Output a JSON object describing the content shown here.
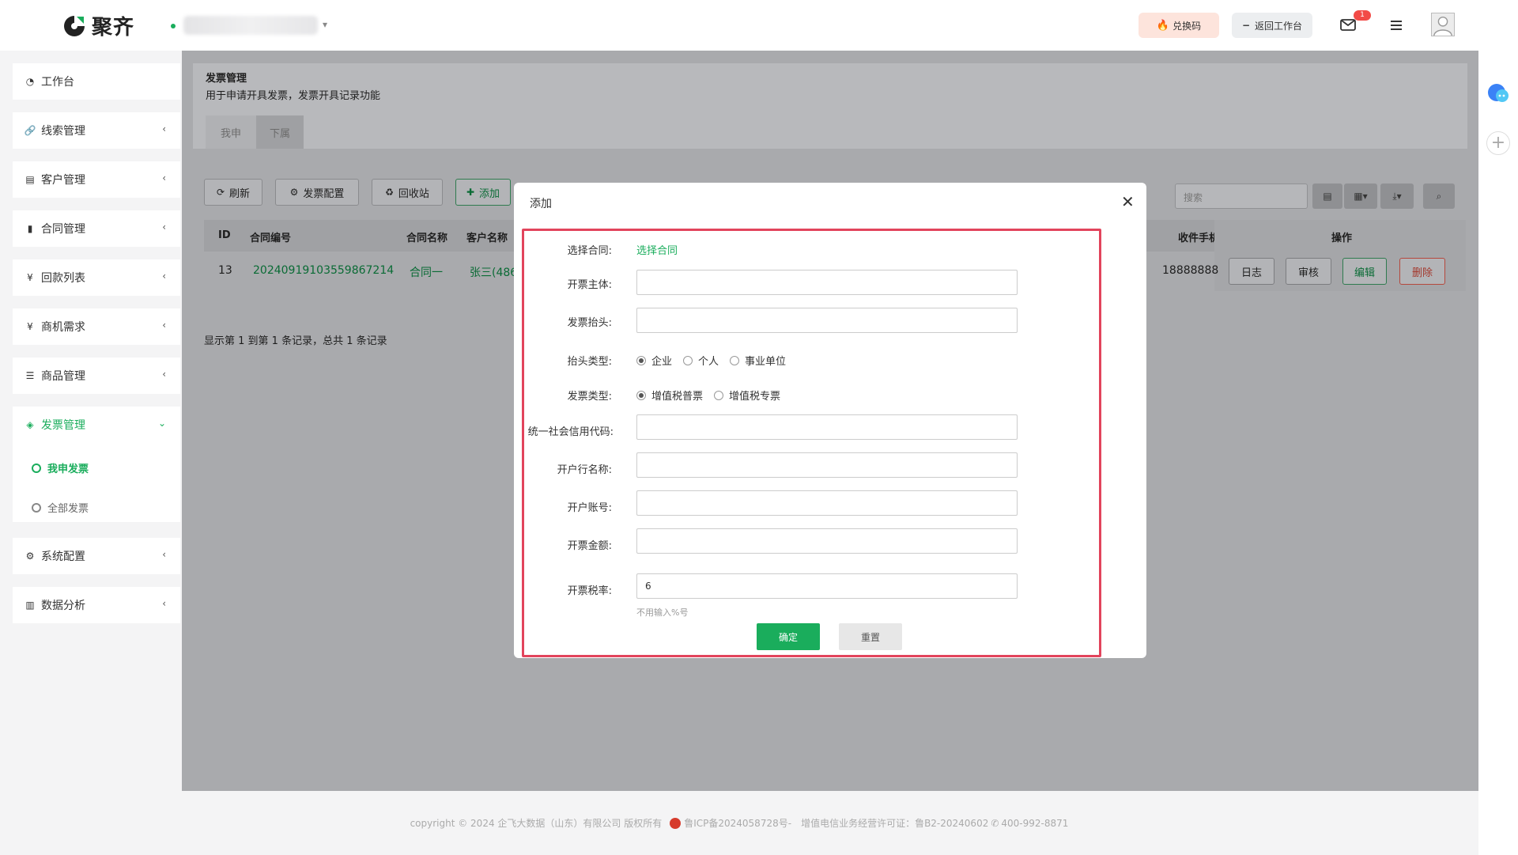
{
  "header": {
    "logo_text": "聚齐",
    "redeem_label": "兑换码",
    "back_label": "返回工作台",
    "mail_badge": "1",
    "accent": "#1aad5c"
  },
  "sidebar": {
    "items": [
      {
        "label": "工作台",
        "icon": "dashboard-icon"
      },
      {
        "label": "线索管理",
        "icon": "link-icon"
      },
      {
        "label": "客户管理",
        "icon": "id-card-icon"
      },
      {
        "label": "合同管理",
        "icon": "bookmark-icon"
      },
      {
        "label": "回款列表",
        "icon": "yen-icon"
      },
      {
        "label": "商机需求",
        "icon": "yen-icon"
      },
      {
        "label": "商品管理",
        "icon": "list-icon"
      },
      {
        "label": "发票管理",
        "icon": "tag-icon"
      },
      {
        "label": "系统配置",
        "icon": "gears-icon"
      },
      {
        "label": "数据分析",
        "icon": "bar-chart-icon"
      }
    ],
    "sub_items": [
      {
        "label": "我申发票",
        "active": true
      },
      {
        "label": "全部发票",
        "active": false
      }
    ]
  },
  "page": {
    "title": "发票管理",
    "description": "用于申请开具发票，发票开具记录功能",
    "tabs": [
      "我申",
      "下属"
    ]
  },
  "toolbar": {
    "refresh": "刷新",
    "config": "发票配置",
    "recycle": "回收站",
    "add": "添加",
    "search_placeholder": "搜索"
  },
  "table": {
    "columns": [
      "ID",
      "合同编号",
      "合同名称",
      "客户名称",
      "收件手机",
      "操作"
    ],
    "rows": [
      {
        "id": "13",
        "contract_no": "20240919103559867214",
        "contract_name": "合同一",
        "customer": "张三(486",
        "phone": "18888888"
      }
    ],
    "row_actions": [
      "日志",
      "审核",
      "编辑",
      "删除"
    ],
    "summary": "显示第 1 到第 1 条记录，总共 1 条记录"
  },
  "modal": {
    "title": "添加",
    "fields": {
      "contract_label": "选择合同:",
      "contract_link": "选择合同",
      "issuer_label": "开票主体:",
      "header_label": "发票抬头:",
      "header_type_label": "抬头类型:",
      "header_types": [
        "企业",
        "个人",
        "事业单位"
      ],
      "invoice_type_label": "发票类型:",
      "invoice_types": [
        "增值税普票",
        "增值税专票"
      ],
      "credit_code_label": "统一社会信用代码:",
      "bank_name_label": "开户行名称:",
      "account_label": "开户账号:",
      "amount_label": "开票金额:",
      "tax_rate_label": "开票税率:",
      "tax_rate_value": "6",
      "tax_rate_hint": "不用输入%号"
    },
    "confirm": "确定",
    "reset": "重置"
  },
  "footer": {
    "copyright": "copyright © 2024 企飞大数据（山东）有限公司 版权所有",
    "icp": "鲁ICP备2024058728号-",
    "license": "增值电信业务经营许可证：鲁B2-20240602",
    "phone": "400-992-8871"
  }
}
